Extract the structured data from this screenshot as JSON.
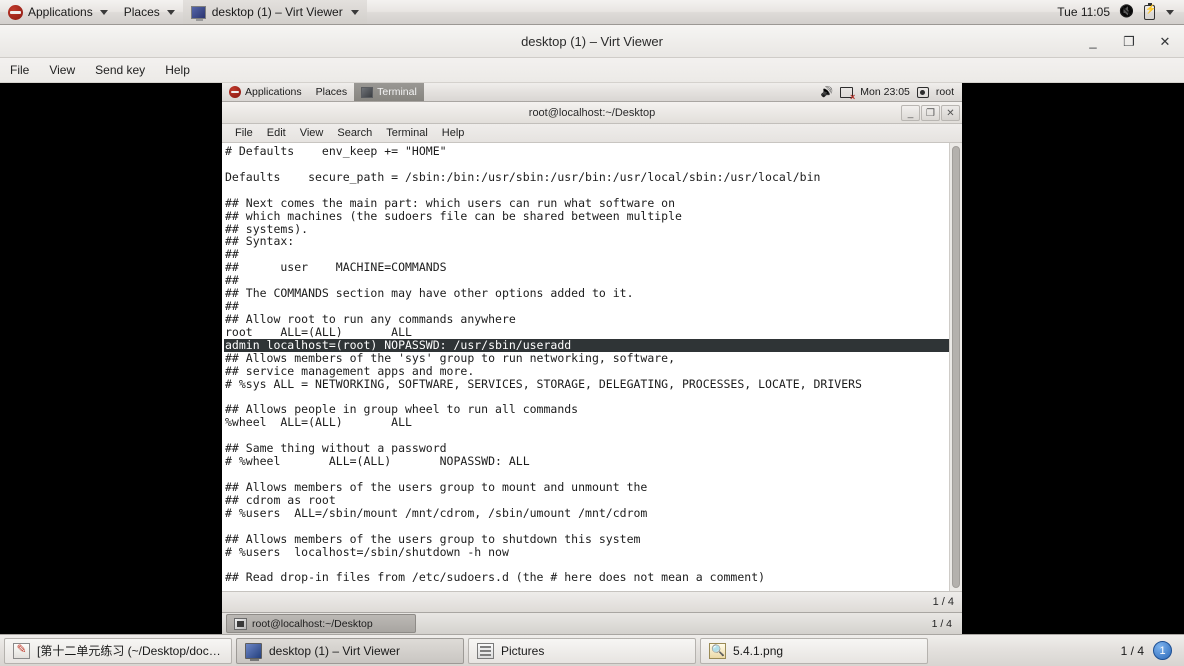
{
  "host_panel": {
    "applications_label": "Applications",
    "places_label": "Places",
    "window_button_label": "desktop (1) – Virt Viewer",
    "clock": "Tue 11:05",
    "icons": {
      "logo": "fedora-logo",
      "volume": "volume-mute-icon",
      "battery": "battery-icon",
      "dropdown": "chevron-down-icon"
    }
  },
  "virt_viewer": {
    "title": "desktop (1) – Virt Viewer",
    "minimize_label": "_",
    "maximize_label": "❐",
    "close_label": "✕",
    "menu": [
      "File",
      "View",
      "Send key",
      "Help"
    ]
  },
  "guest_panel": {
    "applications_label": "Applications",
    "places_label": "Places",
    "active_window_label": "Terminal",
    "clock": "Mon 23:05",
    "user": "root",
    "icons": {
      "volume": "volume-icon",
      "network": "network-disconnected-icon",
      "user": "user-icon"
    }
  },
  "terminal": {
    "title": "root@localhost:~/Desktop",
    "minimize_label": "_",
    "maximize_label": "❐",
    "close_label": "✕",
    "menu": [
      "File",
      "Edit",
      "View",
      "Search",
      "Terminal",
      "Help"
    ],
    "status_right": "1 / 4",
    "lines": [
      {
        "text": "# Defaults    env_keep += \"HOME\"",
        "highlight": false
      },
      {
        "text": "",
        "highlight": false
      },
      {
        "text": "Defaults    secure_path = /sbin:/bin:/usr/sbin:/usr/bin:/usr/local/sbin:/usr/local/bin",
        "highlight": false
      },
      {
        "text": "",
        "highlight": false
      },
      {
        "text": "## Next comes the main part: which users can run what software on",
        "highlight": false
      },
      {
        "text": "## which machines (the sudoers file can be shared between multiple",
        "highlight": false
      },
      {
        "text": "## systems).",
        "highlight": false
      },
      {
        "text": "## Syntax:",
        "highlight": false
      },
      {
        "text": "##",
        "highlight": false
      },
      {
        "text": "##      user    MACHINE=COMMANDS",
        "highlight": false
      },
      {
        "text": "##",
        "highlight": false
      },
      {
        "text": "## The COMMANDS section may have other options added to it.",
        "highlight": false
      },
      {
        "text": "##",
        "highlight": false
      },
      {
        "text": "## Allow root to run any commands anywhere",
        "highlight": false
      },
      {
        "text": "root    ALL=(ALL)       ALL",
        "highlight": false
      },
      {
        "text": "admin localhost=(root) NOPASSWD: /usr/sbin/useradd",
        "highlight": true
      },
      {
        "text": "## Allows members of the 'sys' group to run networking, software,",
        "highlight": false
      },
      {
        "text": "## service management apps and more.",
        "highlight": false
      },
      {
        "text": "# %sys ALL = NETWORKING, SOFTWARE, SERVICES, STORAGE, DELEGATING, PROCESSES, LOCATE, DRIVERS",
        "highlight": false
      },
      {
        "text": "",
        "highlight": false
      },
      {
        "text": "## Allows people in group wheel to run all commands",
        "highlight": false
      },
      {
        "text": "%wheel  ALL=(ALL)       ALL",
        "highlight": false
      },
      {
        "text": "",
        "highlight": false
      },
      {
        "text": "## Same thing without a password",
        "highlight": false
      },
      {
        "text": "# %wheel       ALL=(ALL)       NOPASSWD: ALL",
        "highlight": false
      },
      {
        "text": "",
        "highlight": false
      },
      {
        "text": "## Allows members of the users group to mount and unmount the",
        "highlight": false
      },
      {
        "text": "## cdrom as root",
        "highlight": false
      },
      {
        "text": "# %users  ALL=/sbin/mount /mnt/cdrom, /sbin/umount /mnt/cdrom",
        "highlight": false
      },
      {
        "text": "",
        "highlight": false
      },
      {
        "text": "## Allows members of the users group to shutdown this system",
        "highlight": false
      },
      {
        "text": "# %users  localhost=/sbin/shutdown -h now",
        "highlight": false
      },
      {
        "text": "",
        "highlight": false
      },
      {
        "text": "## Read drop-in files from /etc/sudoers.d (the # here does not mean a comment)",
        "highlight": false
      }
    ]
  },
  "guest_taskbar": {
    "window_label": "root@localhost:~/Desktop",
    "workspace_count": "1 / 4"
  },
  "host_taskbar": {
    "items": [
      {
        "label": "[第十二单元练习 (~/Desktop/docs...",
        "icon": "text-editor-icon",
        "active": false
      },
      {
        "label": "desktop (1) – Virt Viewer",
        "icon": "monitor-icon",
        "active": true
      },
      {
        "label": "Pictures",
        "icon": "file-manager-icon",
        "active": false
      },
      {
        "label": "5.4.1.png",
        "icon": "image-viewer-icon",
        "active": false
      }
    ],
    "workspace_count": "1 / 4",
    "workspace_badge": "1"
  },
  "colors": {
    "panel_bg": "#e4e1de",
    "terminal_bg": "#ffffff",
    "terminal_fg": "#1c1c1c",
    "highlight_bg": "#2f3436",
    "highlight_fg": "#ffffff",
    "guest_area_bg": "#000000",
    "badge_blue": "#2a68b8"
  }
}
